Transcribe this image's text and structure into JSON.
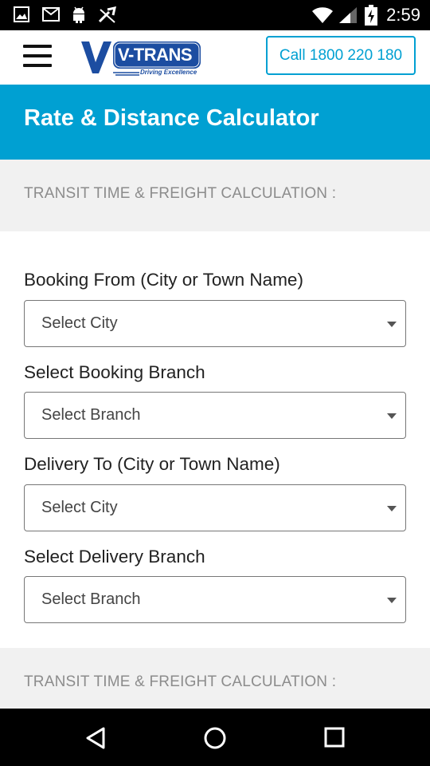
{
  "status_bar": {
    "time": "2:59",
    "left_icons": [
      "image-icon",
      "gmail-icon",
      "android-icon",
      "wrench-icon"
    ],
    "right_icons": [
      "wifi-icon",
      "cell-signal-icon",
      "battery-charging-icon"
    ]
  },
  "header": {
    "logo_text": "V-TRANS",
    "logo_tagline": "Driving Excellence",
    "call_button_label": "Call 1800 220 180"
  },
  "banner": {
    "title": "Rate & Distance Calculator"
  },
  "sections": {
    "top_label": "TRANSIT TIME & FREIGHT CALCULATION :",
    "bottom_label": "TRANSIT TIME & FREIGHT CALCULATION :"
  },
  "form": {
    "booking_from": {
      "label": "Booking From (City or Town Name)",
      "value": "Select City"
    },
    "booking_branch": {
      "label": "Select Booking Branch",
      "value": "Select Branch"
    },
    "delivery_to": {
      "label": "Delivery To (City or Town Name)",
      "value": "Select City"
    },
    "delivery_branch": {
      "label": "Select Delivery Branch",
      "value": "Select Branch"
    }
  },
  "nav_bar": {
    "buttons": [
      "back-icon",
      "home-icon",
      "recents-icon"
    ]
  },
  "colors": {
    "accent": "#00a0d2",
    "logo_blue": "#1c4da1",
    "section_bg": "#f1f1f1",
    "section_text": "#8c8c8c"
  }
}
